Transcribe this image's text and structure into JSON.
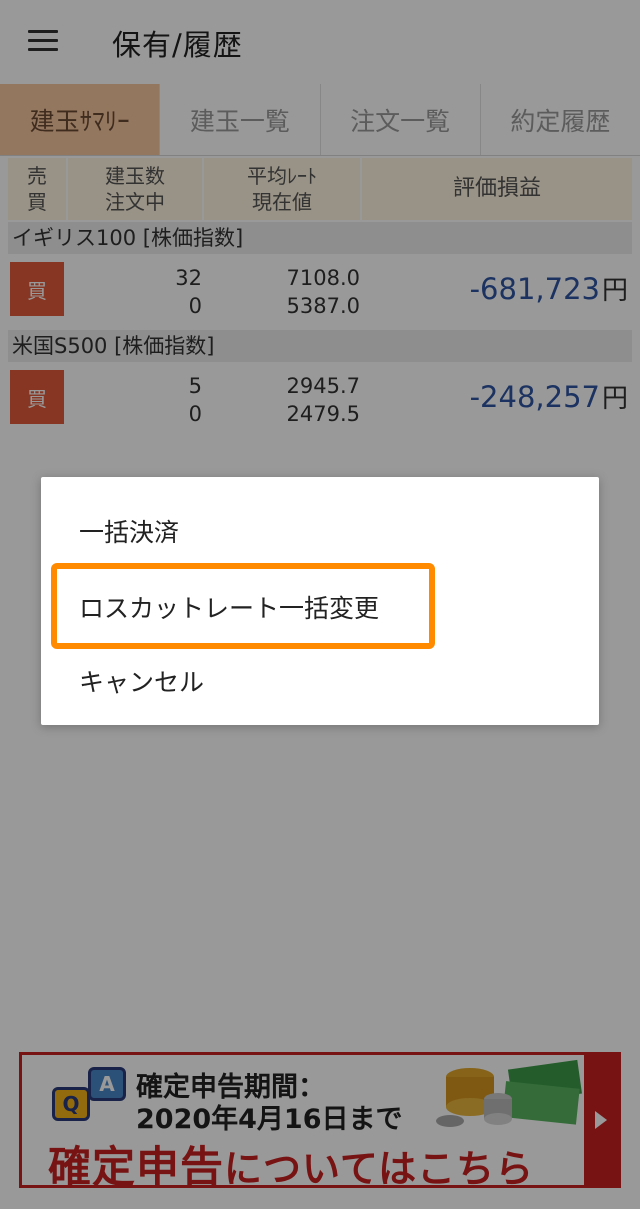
{
  "appbar": {
    "title": "保有/履歴"
  },
  "tabs": [
    {
      "label": "建玉ｻﾏﾘｰ",
      "active": true
    },
    {
      "label": "建玉一覧",
      "active": false
    },
    {
      "label": "注文一覧",
      "active": false
    },
    {
      "label": "約定履歴",
      "active": false
    }
  ],
  "table_header": {
    "col1": [
      "売",
      "買"
    ],
    "col2": [
      "建玉数",
      "注文中"
    ],
    "col3": [
      "平均ﾚｰﾄ",
      "現在値"
    ],
    "col4": "評価損益"
  },
  "sections": [
    {
      "title": "イギリス100 [株価指数]",
      "side": "買",
      "qty": "32",
      "orders": "0",
      "avg_rate": "7108.0",
      "current": "5387.0",
      "pnl": "-681,723",
      "unit": "円"
    },
    {
      "title": "米国S500 [株価指数]",
      "side": "買",
      "qty": "5",
      "orders": "0",
      "avg_rate": "2945.7",
      "current": "2479.5",
      "pnl": "-248,257",
      "unit": "円"
    }
  ],
  "dialog": {
    "items": [
      "一括決済",
      "ロスカットレート一括変更",
      "キャンセル"
    ],
    "highlight_color": "#ff8a00"
  },
  "banner": {
    "line1": "確定申告期間：",
    "line2": "2020年4月16日まで",
    "line3_big": "確定申告",
    "line3_small": "についてはこちら",
    "q": "Q",
    "a": "A",
    "accent": "#c72020"
  },
  "colors": {
    "pnl_negative": "#2f55a4",
    "buy_badge": "#e05a3a",
    "active_tab": "#f7c79f"
  }
}
